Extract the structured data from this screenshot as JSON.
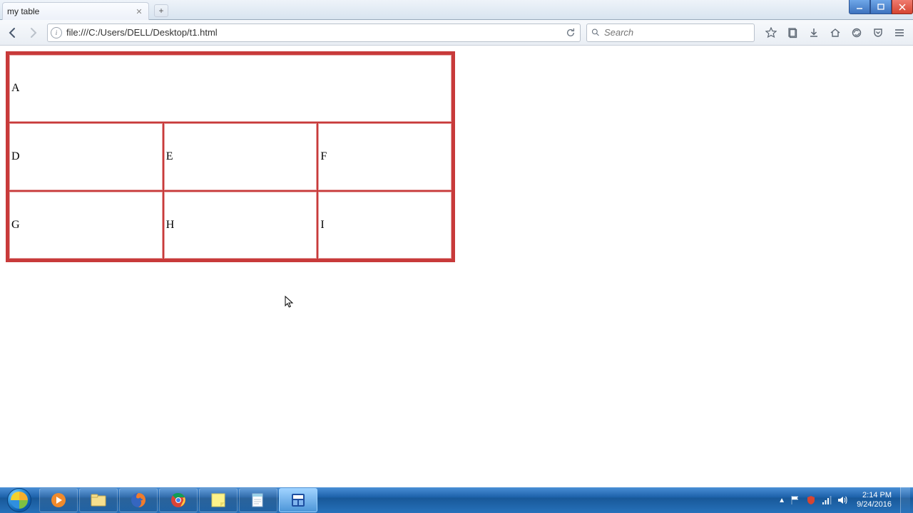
{
  "tab": {
    "title": "my table"
  },
  "url": "file:///C:/Users/DELL/Desktop/t1.html",
  "search": {
    "placeholder": "Search"
  },
  "table": {
    "rows": [
      [
        "A"
      ],
      [
        "D",
        "E",
        "F"
      ],
      [
        "G",
        "H",
        "I"
      ]
    ]
  },
  "clock": {
    "time": "2:14 PM",
    "date": "9/24/2016"
  }
}
